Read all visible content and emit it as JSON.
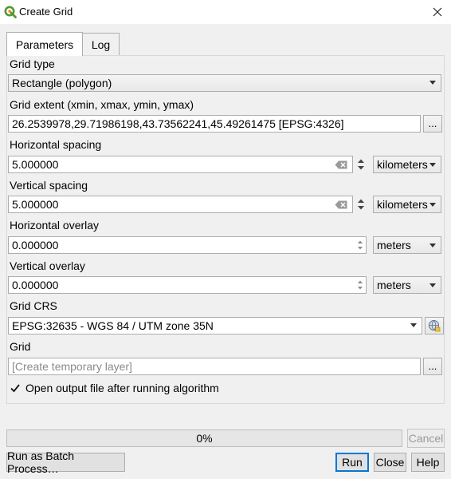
{
  "window": {
    "title": "Create Grid",
    "close_icon": "close-icon"
  },
  "tabs": [
    {
      "label": "Parameters",
      "active": true
    },
    {
      "label": "Log",
      "active": false
    }
  ],
  "params": {
    "grid_type": {
      "label": "Grid type",
      "value": "Rectangle (polygon)"
    },
    "grid_extent": {
      "label": "Grid extent (xmin, xmax, ymin, ymax)",
      "value": "26.2539978,29.71986198,43.73562241,45.49261475 [EPSG:4326]",
      "button": "..."
    },
    "h_spacing": {
      "label": "Horizontal spacing",
      "value": "5.000000",
      "unit": "kilometers"
    },
    "v_spacing": {
      "label": "Vertical spacing",
      "value": "5.000000",
      "unit": "kilometers"
    },
    "h_overlay": {
      "label": "Horizontal overlay",
      "value": "0.000000",
      "unit": "meters"
    },
    "v_overlay": {
      "label": "Vertical overlay",
      "value": "0.000000",
      "unit": "meters"
    },
    "grid_crs": {
      "label": "Grid CRS",
      "value": "EPSG:32635 - WGS 84 / UTM zone 35N"
    },
    "grid_output": {
      "label": "Grid",
      "placeholder": "[Create temporary layer]",
      "button": "..."
    },
    "open_output": {
      "label": "Open output file after running algorithm",
      "checked": true
    }
  },
  "progress": {
    "percent": 0,
    "text": "0%"
  },
  "buttons": {
    "cancel": "Cancel",
    "batch": "Run as Batch Process…",
    "run": "Run",
    "close": "Close",
    "help": "Help"
  },
  "colors": {
    "qgis_green": "#589632",
    "accent_blue": "#0078d7"
  }
}
